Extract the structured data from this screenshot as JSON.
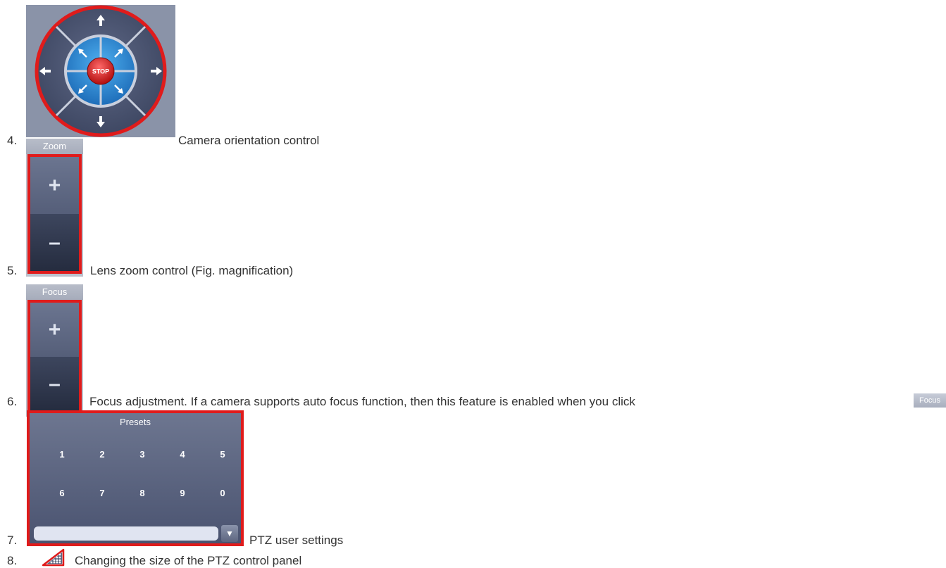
{
  "items": [
    {
      "number": "4.",
      "text": "Camera orientation control"
    },
    {
      "number": "5.",
      "text": "Lens zoom control (Fig. magnification)"
    },
    {
      "number": "6.",
      "text": "Focus adjustment. If a camera supports auto focus function, then this feature is enabled when you click"
    },
    {
      "number": "7.",
      "text": "PTZ user settings"
    },
    {
      "number": "8.",
      "text": "Changing the size of the PTZ control panel"
    }
  ],
  "joystick": {
    "stop_label": "STOP"
  },
  "zoom": {
    "title": "Zoom",
    "plus": "+",
    "minus": "–"
  },
  "focus": {
    "title": "Focus",
    "plus": "+",
    "minus": "–",
    "badge": "Focus"
  },
  "presets": {
    "title": "Presets",
    "buttons": [
      "1",
      "2",
      "3",
      "4",
      "5",
      "6",
      "7",
      "8",
      "9",
      "0"
    ],
    "input_value": "",
    "dropdown_icon": "chevron-down-icon"
  },
  "resize": {
    "icon": "resize-grip-icon"
  },
  "colors": {
    "highlight": "#e01b1b",
    "panel": "#4a5370",
    "joystick_blue": "#2f8fd8"
  }
}
